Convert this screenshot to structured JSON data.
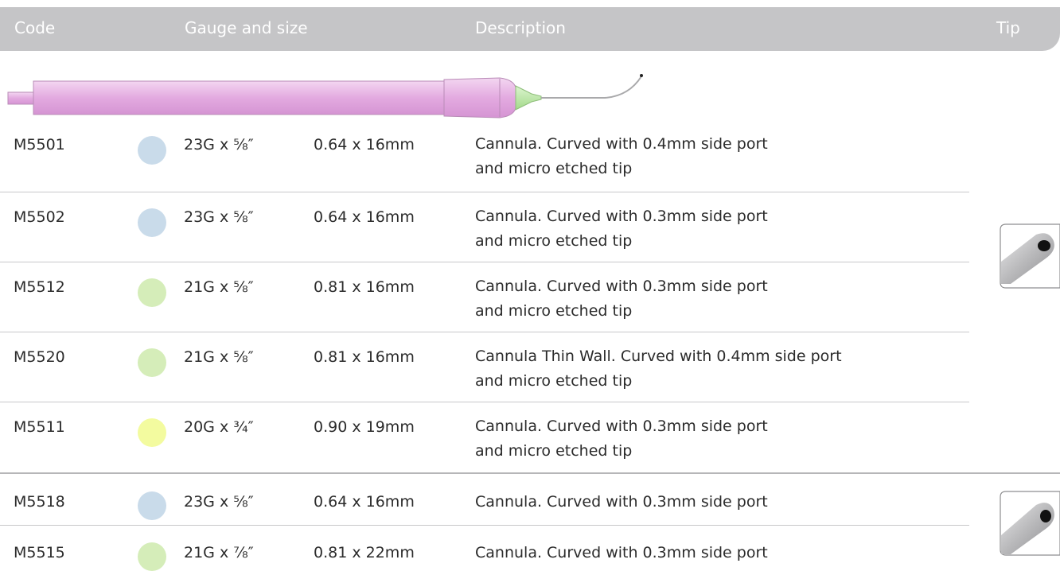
{
  "header": {
    "code": "Code",
    "gauge_size": "Gauge and size",
    "description": "Description",
    "tip": "Tip"
  },
  "colors": {
    "header_bg": "#c5c5c7",
    "blue_hub": "#c9dbea",
    "green_hub": "#d5edb9",
    "yellow_hub": "#f3fb9f",
    "cannula_body": "#e7b5e5",
    "cannula_tip": "#b9e6a3"
  },
  "rows": [
    {
      "code": "M5501",
      "gauge": "23G x ⅝″",
      "metric": "0.64 x 16mm",
      "desc1": "Cannula. Curved with 0.4mm side port",
      "desc2": "and micro etched tip",
      "hub": "blue"
    },
    {
      "code": "M5502",
      "gauge": "23G x ⅝″",
      "metric": "0.64 x 16mm",
      "desc1": "Cannula. Curved with 0.3mm side port",
      "desc2": "and micro etched tip",
      "hub": "blue"
    },
    {
      "code": "M5512",
      "gauge": "21G x ⅝″",
      "metric": "0.81 x 16mm",
      "desc1": "Cannula. Curved with 0.3mm side port",
      "desc2": "and micro etched tip",
      "hub": "green"
    },
    {
      "code": "M5520",
      "gauge": "21G x ⅝″",
      "metric": "0.81 x 16mm",
      "desc1": "Cannula Thin Wall. Curved with 0.4mm side port",
      "desc2": "and micro etched tip",
      "hub": "green"
    },
    {
      "code": "M5511",
      "gauge": "20G x ¾″",
      "metric": "0.90 x 19mm",
      "desc1": "Cannula. Curved with 0.3mm side port",
      "desc2": "and micro etched tip",
      "hub": "yellow"
    },
    {
      "code": "M5518",
      "gauge": "23G x ⅝″",
      "metric": "0.64 x 16mm",
      "desc1": "Cannula. Curved with 0.3mm side port",
      "desc2": "",
      "hub": "blue"
    },
    {
      "code": "M5515",
      "gauge": "21G x ⅞″",
      "metric": "0.81 x 22mm",
      "desc1": "Cannula. Curved with 0.3mm side port",
      "desc2": "",
      "hub": "green"
    }
  ],
  "icons": {
    "product": "curved-cannula-illustration",
    "tip1": "side-port-tip-icon",
    "tip2": "side-port-tip-icon"
  }
}
